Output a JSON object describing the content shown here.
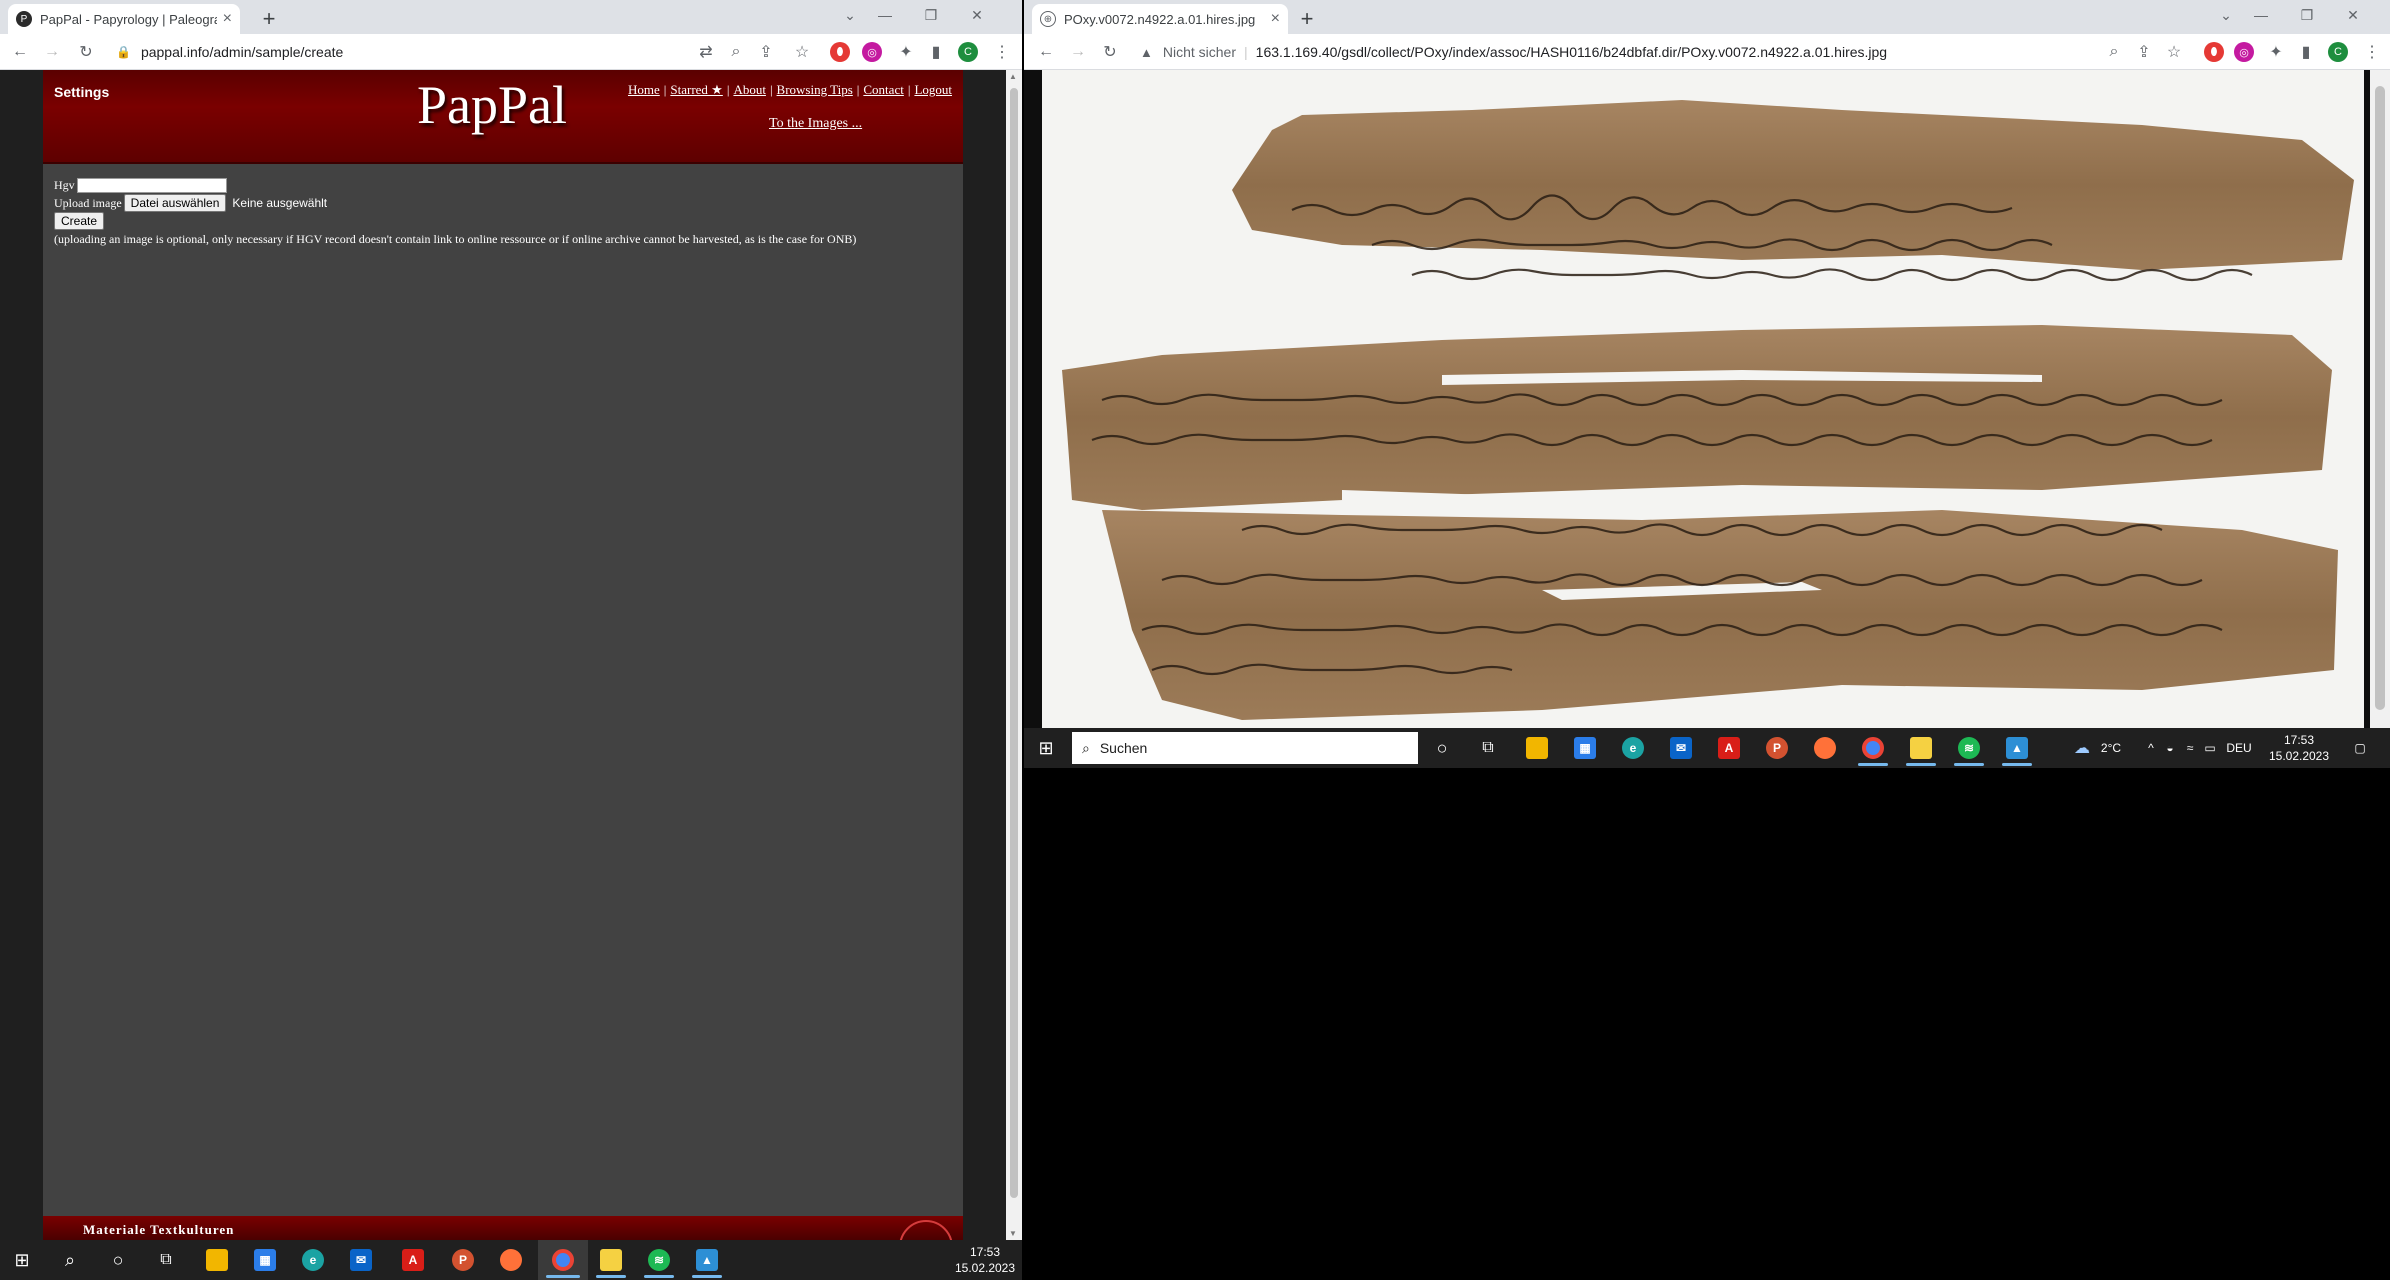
{
  "left_browser": {
    "tab_title": "PapPal - Papyrology | Paleograph",
    "url": "pappal.info/admin/sample/create"
  },
  "pappal": {
    "settings_label": "Settings",
    "logo": "PapPal",
    "nav": [
      "Home",
      "Starred ★",
      "About",
      "Browsing Tips",
      "Contact",
      "Logout"
    ],
    "to_images": "To the Images ...",
    "form": {
      "hgv_label": "Hgv",
      "hgv_value": "",
      "upload_label": "Upload image",
      "file_button": "Datei auswählen",
      "file_status": "Keine ausgewählt",
      "create_button": "Create",
      "note": "(uploading an image is optional, only necessary if HGV record doesn't contain link to online ressource or if online archive cannot be harvested, as is the case for ONB)"
    },
    "footer_text": "Materiale Textkulturen"
  },
  "right_browser": {
    "tab_title": "POxy.v0072.n4922.a.01.hires.jpg",
    "security_label": "Nicht sicher",
    "url": "163.1.169.40/gsdl/collect/POxy/index/assoc/HASH0116/b24dbfaf.dir/POxy.v0072.n4922.a.01.hires.jpg"
  },
  "taskbar_right": {
    "search_placeholder": "Suchen",
    "weather": "2°C",
    "language": "DEU",
    "time": "17:53",
    "date": "15.02.2023"
  },
  "taskbar_left": {
    "time": "17:53",
    "date": "15.02.2023"
  },
  "profile_initial": "C",
  "icons": [
    "windows-start-icon",
    "search-icon",
    "cortana-icon",
    "task-view-icon",
    "file-explorer-icon",
    "store-icon",
    "edge-icon",
    "mail-icon",
    "acrobat-icon",
    "powerpoint-icon",
    "firefox-icon",
    "chrome-icon",
    "notepad-icon",
    "spotify-icon",
    "photos-icon"
  ],
  "colors": {
    "pappal_red": "#7a0000",
    "pappal_bg": "#424242",
    "taskbar": "#202020",
    "papyrus": "#9a7a55"
  }
}
